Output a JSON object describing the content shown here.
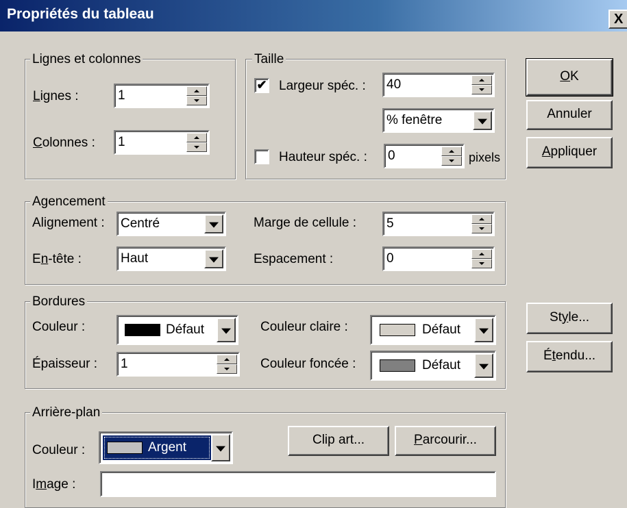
{
  "window": {
    "title": "Propriétés du tableau",
    "close_glyph": "X"
  },
  "rows_cols": {
    "legend": "Lignes et colonnes",
    "rows_label_u": "L",
    "rows_label_rest": "ignes :",
    "rows_value": "1",
    "cols_label_u": "C",
    "cols_label_rest": "olonnes :",
    "cols_value": "1"
  },
  "size": {
    "legend": "Taille",
    "width_checked": true,
    "width_check_glyph": "✔",
    "width_label": "Largeur spéc. :",
    "width_value": "40",
    "width_unit": "% fenêtre",
    "height_checked": false,
    "height_label": "Hauteur spéc. :",
    "height_value": "0",
    "height_unit": "pixels"
  },
  "layout": {
    "legend": "Agencement",
    "align_label_a": "Ali",
    "align_label_u": "g",
    "align_label_b": "nement :",
    "align_value": "Centré",
    "header_label_a": "E",
    "header_label_u": "n",
    "header_label_b": "-tête :",
    "header_value": "Haut",
    "padding_label": "Marge de cellule :",
    "padding_value": "5",
    "spacing_label": "Espacement :",
    "spacing_value": "0"
  },
  "borders": {
    "legend": "Bordures",
    "color_label": "Couleur :",
    "color_value": "Défaut",
    "color_swatch": "#000000",
    "thickness_label": "Épaisseur :",
    "thickness_value": "1",
    "light_label": "Couleur claire :",
    "light_value": "Défaut",
    "light_swatch": "#d4d0c8",
    "dark_label": "Couleur foncée :",
    "dark_value": "Défaut",
    "dark_swatch": "#808080"
  },
  "background": {
    "legend": "Arrière-plan",
    "color_label": "Couleur :",
    "color_value": "Argent",
    "color_swatch": "#c0c0c0",
    "clipart_label": "Clip art...",
    "browse_u": "P",
    "browse_rest": "arcourir...",
    "image_label_a": "I",
    "image_label_u": "m",
    "image_label_b": "age :",
    "image_value": ""
  },
  "buttons": {
    "ok_u": "O",
    "ok_rest": "K",
    "cancel": "Annuler",
    "apply_u": "A",
    "apply_rest": "ppliquer",
    "style_a": "St",
    "style_u": "y",
    "style_b": "le...",
    "extended_a": "É",
    "extended_u": "t",
    "extended_b": "endu..."
  },
  "colors": {
    "titlebar_start": "#0a246a",
    "face": "#d4d0c8",
    "highlight": "#0a246a"
  }
}
